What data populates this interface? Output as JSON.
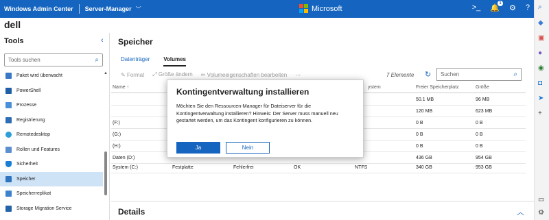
{
  "header": {
    "app_title": "Windows Admin Center",
    "server_label": "Server-Manager",
    "brand": "Microsoft",
    "notification_count": "1"
  },
  "hostname": "dell",
  "tools": {
    "title": "Tools",
    "search_placeholder": "Tools suchen",
    "items": [
      "Paket wird überwacht",
      "PowerShell",
      "Prozesse",
      "Registrierung",
      "Remotedesktop",
      "Rollen und Features",
      "Sicherheit",
      "Speicher",
      "Speicherreplikat",
      "Storage Migration Service"
    ],
    "selected": "Speicher"
  },
  "main": {
    "title": "Speicher",
    "tabs": [
      "Datenträger",
      "Volumes"
    ],
    "active_tab": "Volumes",
    "toolbar": {
      "format": "Format",
      "resize": "Größe ändern",
      "edit": "Volumeeigenschaften bearbeiten",
      "more": "···"
    },
    "count": "7 Elemente",
    "search_placeholder": "Suchen",
    "columns": {
      "name": "Name ↑",
      "fs": "ystem",
      "free": "Freier Speicherplatz",
      "size": "Größe"
    },
    "rows": [
      {
        "name": "",
        "type": "",
        "health": "",
        "status": "",
        "fs": "",
        "free": "50.1 MB",
        "size": "96 MB"
      },
      {
        "name": "",
        "type": "",
        "health": "",
        "status": "",
        "fs": "",
        "free": "120 MB",
        "size": "623 MB"
      },
      {
        "name": "(F:)",
        "type": "",
        "health": "",
        "status": "",
        "fs": "",
        "free": "0 B",
        "size": "0 B"
      },
      {
        "name": "(G:)",
        "type": "",
        "health": "",
        "status": "",
        "fs": "",
        "free": "0 B",
        "size": "0 B"
      },
      {
        "name": "(H:)",
        "type": "",
        "health": "",
        "status": "",
        "fs": "",
        "free": "0 B",
        "size": "0 B"
      },
      {
        "name": "Daten (D:)",
        "type": "",
        "health": "",
        "status": "",
        "fs": "",
        "free": "436 GB",
        "size": "954 GB"
      },
      {
        "name": "System (C:)",
        "type": "Festplatte",
        "health": "Fehlerfrei",
        "status": "OK",
        "fs": "NTFS",
        "free": "340 GB",
        "size": "953 GB"
      }
    ],
    "details_title": "Details"
  },
  "dialog": {
    "title": "Kontingentverwaltung installieren",
    "body": "Möchten Sie den Ressourcen-Manager für Dateiserver für die Kontingentverwaltung installieren? Hinweis: Der Server muss manuell neu gestartet werden, um das Kontingent konfigurieren zu können.",
    "yes": "Ja",
    "no": "Nein"
  },
  "colors": {
    "accent": "#1565c0",
    "selected_bg": "#cfe3f7"
  }
}
